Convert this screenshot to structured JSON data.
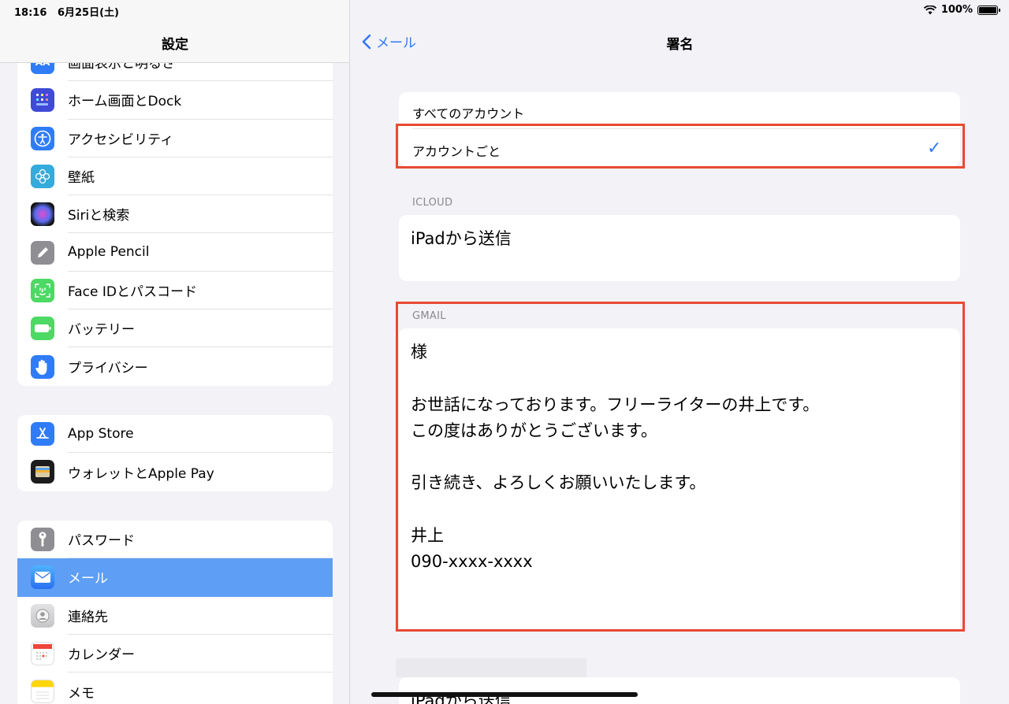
{
  "status": {
    "time": "18:16",
    "date": "6月25日(土)",
    "battery": "100%"
  },
  "sidebar": {
    "title": "設定",
    "groups": [
      {
        "items": [
          {
            "label": "画面表示と明るさ",
            "icon": "display-brightness-icon",
            "color": "#2f7cf6"
          },
          {
            "label": "ホーム画面とDock",
            "icon": "home-screen-icon",
            "color": "#3f4ad6"
          },
          {
            "label": "アクセシビリティ",
            "icon": "accessibility-icon",
            "color": "#2f7cf6"
          },
          {
            "label": "壁紙",
            "icon": "wallpaper-icon",
            "color": "#35aadc"
          },
          {
            "label": "Siriと検索",
            "icon": "siri-icon",
            "color": "#222222"
          },
          {
            "label": "Apple Pencil",
            "icon": "pencil-icon",
            "color": "#8e8e93"
          },
          {
            "label": "Face IDとパスコード",
            "icon": "face-id-icon",
            "color": "#4cd964"
          },
          {
            "label": "バッテリー",
            "icon": "battery-icon",
            "color": "#4cd964"
          },
          {
            "label": "プライバシー",
            "icon": "privacy-hand-icon",
            "color": "#2f7cf6"
          }
        ]
      },
      {
        "items": [
          {
            "label": "App Store",
            "icon": "app-store-icon",
            "color": "#2f7cf6"
          },
          {
            "label": "ウォレットとApple Pay",
            "icon": "wallet-icon",
            "color": "#1c1c1e"
          }
        ]
      },
      {
        "items": [
          {
            "label": "パスワード",
            "icon": "key-icon",
            "color": "#8e8e93"
          },
          {
            "label": "メール",
            "icon": "mail-icon",
            "color": "#2f7cf6"
          },
          {
            "label": "連絡先",
            "icon": "contacts-icon",
            "color": "#c8c8c8"
          },
          {
            "label": "カレンダー",
            "icon": "calendar-icon",
            "color": "#ffffff"
          },
          {
            "label": "メモ",
            "icon": "notes-icon",
            "color": "#ffd60a"
          }
        ]
      }
    ]
  },
  "detail": {
    "back_label": "メール",
    "title": "署名",
    "options": {
      "all_accounts": "すべてのアカウント",
      "per_account": "アカウントごと"
    },
    "icloud": {
      "header": "ICLOUD",
      "signature": "iPadから送信"
    },
    "gmail": {
      "header": "GMAIL",
      "line1": "様",
      "line2": "お世話になっております。フリーライターの井上です。",
      "line3": "この度はありがとうございます。",
      "line4": "引き続き、よろしくお願いいたします。",
      "line5": "井上",
      "line6": "090-xxxx-xxxx"
    },
    "third": {
      "signature": "iPadから送信"
    }
  },
  "colors": {
    "accent": "#3478f6",
    "highlight": "#e84a32",
    "selected_row": "#5e9ef4"
  }
}
